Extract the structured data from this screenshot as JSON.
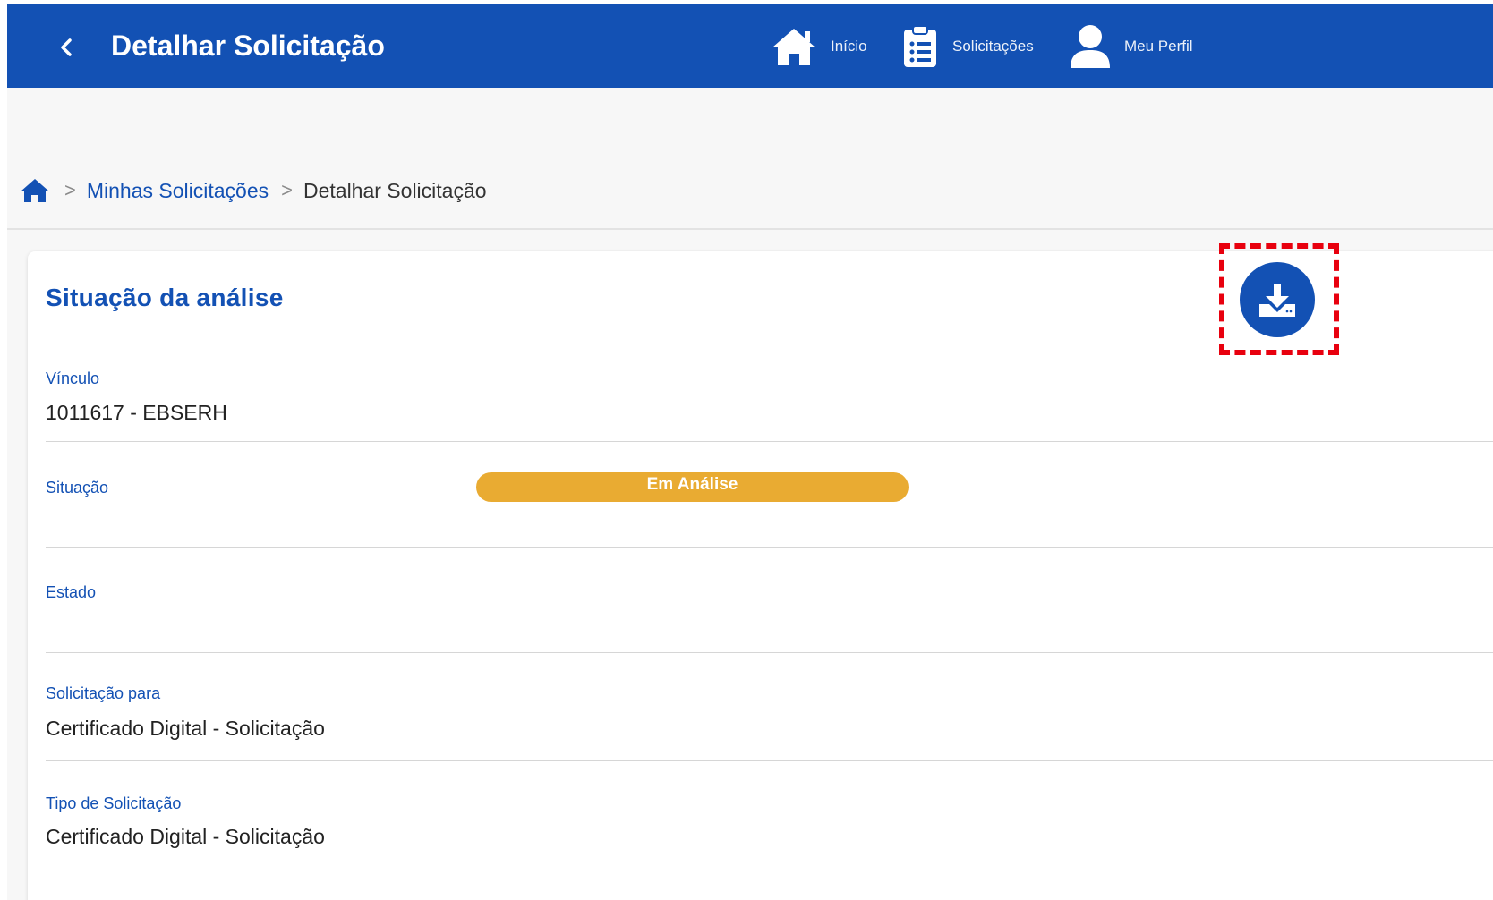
{
  "header": {
    "title": "Detalhar Solicitação",
    "nav": {
      "inicio": "Início",
      "solicitacoes": "Solicitações",
      "perfil": "Meu Perfil"
    },
    "background": "#1351b4"
  },
  "breadcrumb": {
    "link": "Minhas Solicitações",
    "current": "Detalhar Solicitação",
    "separator": ">"
  },
  "card": {
    "title": "Situação da análise",
    "fields": {
      "vinculo": {
        "label": "Vínculo",
        "value": "1011617 - EBSERH"
      },
      "situacao": {
        "label": "Situação",
        "status": "Em Análise",
        "status_color": "#e9ab32"
      },
      "estado": {
        "label": "Estado",
        "value": ""
      },
      "solicitacao_para": {
        "label": "Solicitação para",
        "value": "Certificado Digital - Solicitação"
      },
      "tipo": {
        "label": "Tipo de Solicitação",
        "value": "Certificado Digital - Solicitação"
      }
    },
    "download_icon": "download-icon",
    "highlight_color": "#e8000e"
  }
}
